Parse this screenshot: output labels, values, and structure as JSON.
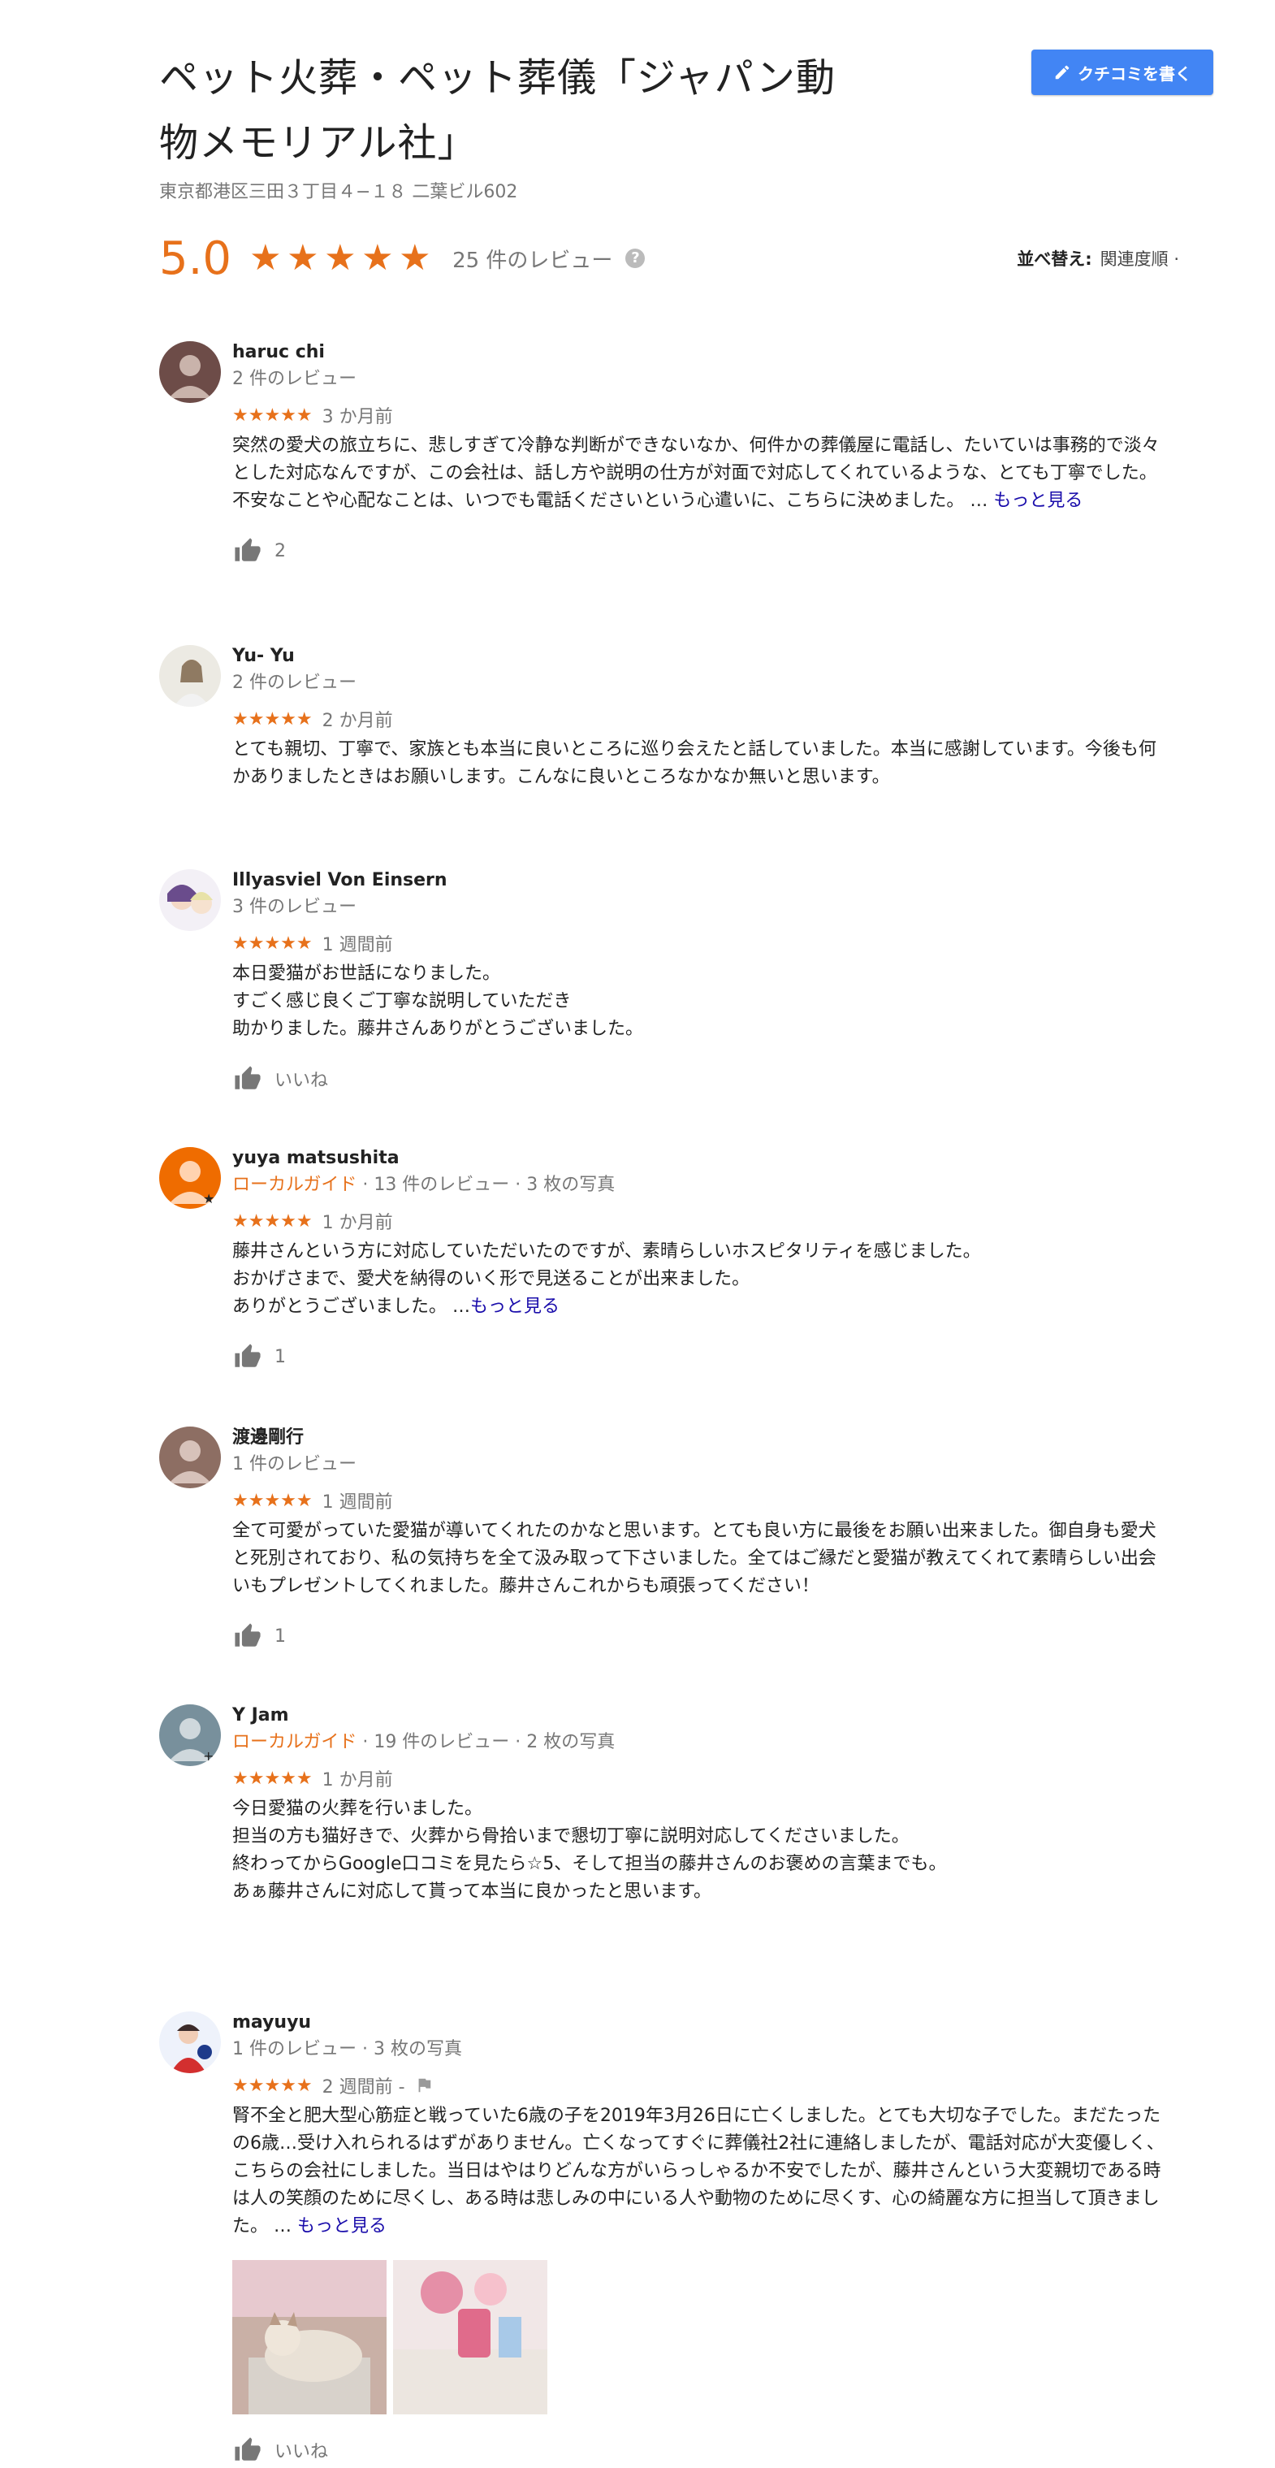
{
  "header": {
    "title_line1": "ペット火葬・ペット葬儀「ジャパン動",
    "title_line2": "物メモリアル社」",
    "address": "東京都港区三田３丁目４−１８ 二葉ビル602",
    "write_review_label": "クチコミを書く"
  },
  "summary": {
    "score": "5.0",
    "review_count": "25 件のレビュー",
    "help_symbol": "?",
    "sort_label": "並べ替え:",
    "sort_value": "関連度順 ·"
  },
  "colors": {
    "star": "#e7711b",
    "link": "#1a0dab",
    "button": "#4285f4"
  },
  "reviews": [
    {
      "name": "haruc chi",
      "meta": "2 件のレビュー",
      "stars": "★★★★★",
      "when": "3 か月前",
      "text": "突然の愛犬の旅立ちに、悲しすぎて冷静な判断ができないなか、何件かの葬儀屋に電話し、たいていは事務的で淡々とした対応なんですが、この会社は、話し方や説明の仕方が対面で対応してくれているような、とても丁寧でした。不安なことや心配なことは、いつでも電話くださいという心遣いに、こちらに決めました。 …",
      "more": "もっと見る",
      "likes": "2"
    },
    {
      "name": "Yu- Yu",
      "meta": "2 件のレビュー",
      "stars": "★★★★★",
      "when": "2 か月前",
      "text": "とても親切、丁寧で、家族とも本当に良いところに巡り会えたと話していました。本当に感謝しています。今後も何かありましたときはお願いします。こんなに良いところなかなか無いと思います。"
    },
    {
      "name": "Illyasviel Von Einsern",
      "meta": "3 件のレビュー",
      "stars": "★★★★★",
      "when": "1 週間前",
      "text1": "本日愛猫がお世話になりました。",
      "text2": "すごく感じ良くご丁寧な説明していただき",
      "text3": "助かりました。藤井さんありがとうございました。",
      "likes": "いいね"
    },
    {
      "name": "yuya matsushita",
      "guide": "ローカルガイド",
      "meta": " · 13 件のレビュー · 3 枚の写真",
      "stars": "★★★★★",
      "when": "1 か月前",
      "text1": "藤井さんという方に対応していただいたのですが、素晴らしいホスピタリティを感じました。",
      "text2": "おかげさまで、愛犬を納得のいく形で見送ることが出来ました。",
      "text3": "ありがとうございました。 …",
      "more": "もっと見る",
      "likes": "1"
    },
    {
      "name": "渡邊剛行",
      "meta": "1 件のレビュー",
      "stars": "★★★★★",
      "when": "1 週間前",
      "text": "全て可愛がっていた愛猫が導いてくれたのかなと思います。とても良い方に最後をお願い出来ました。御自身も愛犬と死別されており、私の気持ちを全て汲み取って下さいました。全てはご縁だと愛猫が教えてくれて素晴らしい出会いもプレゼントしてくれました。藤井さんこれからも頑張ってください！",
      "likes": "1"
    },
    {
      "name": "Y Jam",
      "guide": "ローカルガイド",
      "meta": " · 19 件のレビュー · 2 枚の写真",
      "stars": "★★★★★",
      "when": "1 か月前",
      "text1": "今日愛猫の火葬を行いました。",
      "text2": "担当の方も猫好きで、火葬から骨拾いまで懇切丁寧に説明対応してくださいました。",
      "text3": "終わってからGoogle口コミを見たら☆5、そして担当の藤井さんのお褒めの言葉までも。",
      "text4": "あぁ藤井さんに対応して貰って本当に良かったと思います。"
    },
    {
      "name": "mayuyu",
      "meta": "1 件のレビュー · 3 枚の写真",
      "stars": "★★★★★",
      "when": "2 週間前 -",
      "text": "腎不全と肥大型心筋症と戦っていた6歳の子を2019年3月26日に亡くしました。とても大切な子でした。まだたったの6歳…受け入れられるはずがありません。亡くなってすぐに葬儀社2社に連絡しましたが、電話対応が大変優しく、こちらの会社にしました。当日はやはりどんな方がいらっしゃるか不安でしたが、藤井さんという大変親切である時は人の笑顔のために尽くし、ある時は悲しみの中にいる人や動物のために尽くす、心の綺麗な方に担当して頂きました。 …",
      "more": "もっと見る",
      "likes": "いいね"
    }
  ]
}
